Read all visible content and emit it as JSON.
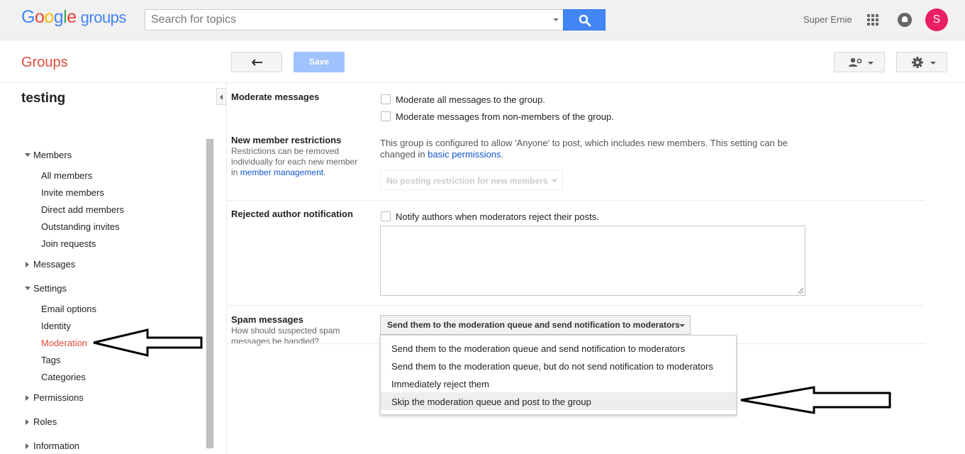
{
  "header": {
    "logo_brand": "Google",
    "logo_product": "groups",
    "search_placeholder": "Search for topics",
    "user_name": "Super Ernie",
    "avatar_letter": "S"
  },
  "toolbar": {
    "section_title": "Groups",
    "save_label": "Save"
  },
  "sidebar": {
    "group_name": "testing",
    "sections": [
      {
        "label": "Members",
        "expanded": true,
        "items": [
          "All members",
          "Invite members",
          "Direct add members",
          "Outstanding invites",
          "Join requests"
        ]
      },
      {
        "label": "Messages",
        "expanded": false,
        "items": []
      },
      {
        "label": "Settings",
        "expanded": true,
        "items": [
          "Email options",
          "Identity",
          "Moderation",
          "Tags",
          "Categories"
        ],
        "active_item": "Moderation"
      },
      {
        "label": "Permissions",
        "expanded": false,
        "items": []
      },
      {
        "label": "Roles",
        "expanded": false,
        "items": []
      },
      {
        "label": "Information",
        "expanded": false,
        "items": []
      }
    ]
  },
  "moderation": {
    "moderate_messages": {
      "label": "Moderate messages",
      "options": [
        "Moderate all messages to the group.",
        "Moderate messages from non-members of the group."
      ]
    },
    "new_member": {
      "label": "New member restrictions",
      "desc_prefix": "Restrictions can be removed individually for each new member in ",
      "desc_link": "member management",
      "desc_suffix": ".",
      "info_prefix": "This group is configured to allow 'Anyone' to post, which includes new members. This setting can be changed in ",
      "info_link": "basic permissions",
      "info_suffix": ".",
      "dropdown_value": "No posting restriction for new members"
    },
    "rejected": {
      "label": "Rejected author notification",
      "option": "Notify authors when moderators reject their posts."
    },
    "spam": {
      "label": "Spam messages",
      "desc": "How should suspected spam messages be handled?",
      "selected": "Send them to the moderation queue and send notification to moderators",
      "options": [
        "Send them to the moderation queue and send notification to moderators",
        "Send them to the moderation queue, but do not send notification to moderators",
        "Immediately reject them",
        "Skip the moderation queue and post to the group"
      ],
      "highlighted_option": "Skip the moderation queue and post to the group"
    }
  },
  "colors": {
    "brand_blue": "#4285f4",
    "accent_red": "#dd4b39",
    "link_blue": "#1155cc",
    "save_disabled": "#a0c3ff"
  }
}
